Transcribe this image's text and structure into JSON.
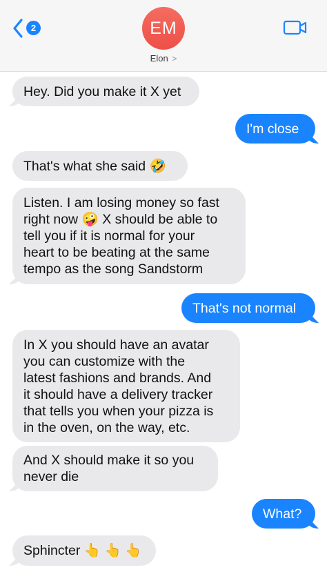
{
  "header": {
    "back_badge": "2",
    "avatar_initials": "EM",
    "contact_name": "Elon",
    "contact_chevron": ">"
  },
  "messages": [
    {
      "from": "them",
      "text": "Hey. Did you make it X yet"
    },
    {
      "from": "me",
      "text": "I'm close"
    },
    {
      "from": "them",
      "text": "That's what she said 🤣"
    },
    {
      "from": "them",
      "text": "Listen. I am losing money so fast\nright now 🤪 X should be able to\ntell you if it is normal for your\nheart to be beating at the same\ntempo as the song Sandstorm"
    },
    {
      "from": "me",
      "text": "That's not normal"
    },
    {
      "from": "them",
      "text": "In X you should have an avatar\nyou can customize with the\nlatest fashions and brands. And\nit should have a delivery tracker\nthat tells you when your pizza is\nin the oven, on the way, etc."
    },
    {
      "from": "them",
      "text": "And X should make it so you\nnever die"
    },
    {
      "from": "me",
      "text": "What?"
    },
    {
      "from": "them",
      "text": "Sphincter 👆 👆 👆"
    }
  ],
  "colors": {
    "outgoing_bubble": "#1a84ff",
    "incoming_bubble": "#e9e9eb",
    "avatar": "#ee4f47",
    "accent": "#1a84ff"
  },
  "icons": {
    "back": "chevron-left-icon",
    "video": "video-camera-icon"
  }
}
